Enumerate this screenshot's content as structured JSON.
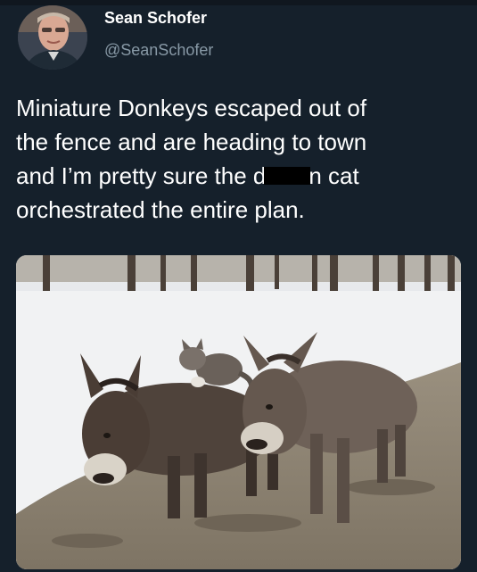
{
  "tweet": {
    "display_name": "Sean Schofer",
    "handle": "@SeanSchofer",
    "text_lines": [
      "Miniature Donkeys escaped out of",
      "the fence and are heading to town",
      "and I’m pretty sure the d",
      "n cat",
      "orchestrated the entire plan."
    ]
  },
  "icons": {
    "avatar": "profile-photo",
    "media": "donkeys-photo"
  },
  "colors": {
    "background": "#15202b",
    "text": "#ffffff",
    "handle": "#8899a6",
    "redaction": "#000000"
  }
}
